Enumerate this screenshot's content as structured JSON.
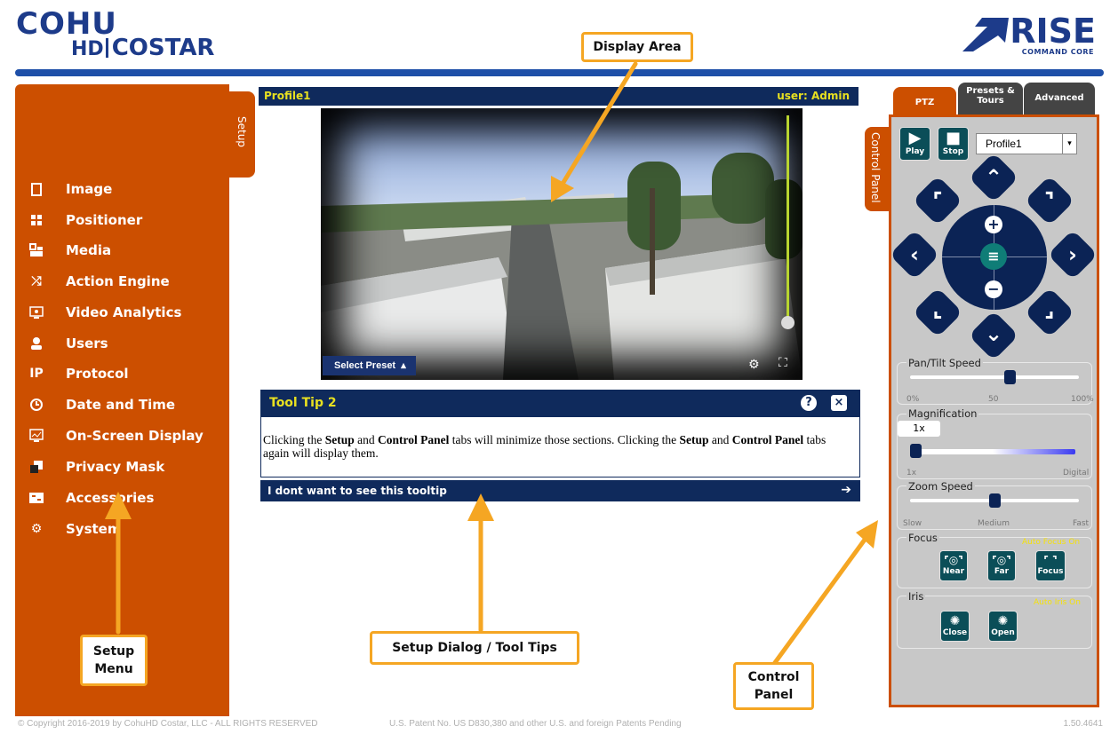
{
  "brand": {
    "cohu": "COHU",
    "hd": "HD",
    "costar": "COSTAR",
    "rise": "RISE",
    "rise_sub": "COMMAND CORE",
    "accent": "#cc4f00",
    "navy": "#0f2a5c"
  },
  "setup_menu": {
    "items": [
      {
        "icon": "image-icon",
        "label": "Image"
      },
      {
        "icon": "positioner-icon",
        "label": "Positioner"
      },
      {
        "icon": "media-icon",
        "label": "Media"
      },
      {
        "icon": "action-engine-icon",
        "label": "Action Engine"
      },
      {
        "icon": "video-analytics-icon",
        "label": "Video Analytics"
      },
      {
        "icon": "users-icon",
        "label": "Users"
      },
      {
        "icon": "protocol-icon",
        "label": "Protocol"
      },
      {
        "icon": "clock-icon",
        "label": "Date and Time"
      },
      {
        "icon": "osd-icon",
        "label": "On-Screen Display"
      },
      {
        "icon": "privacy-mask-icon",
        "label": "Privacy Mask"
      },
      {
        "icon": "accessories-icon",
        "label": "Accessories"
      },
      {
        "icon": "gear-icon",
        "label": "System"
      }
    ],
    "tab_label": "Setup"
  },
  "display": {
    "profile": "Profile1",
    "user": "user: Admin",
    "select_preset": "Select Preset"
  },
  "tooltip": {
    "title": "Tool Tip 2",
    "help": "?",
    "close": "×",
    "body_1": "Clicking the ",
    "setup": "Setup",
    "and": " and ",
    "control_panel": "Control Panel",
    "body_2": " tabs will minimize those sections. Clicking the ",
    "body_3": " tabs again will display them.",
    "dismiss": "I dont want to see this tooltip"
  },
  "control_panel": {
    "tabs": [
      "PTZ",
      "Presets & Tours",
      "Advanced"
    ],
    "side_tab": "Control Panel",
    "play": "Play",
    "stop": "Stop",
    "profile": "Profile1",
    "pan_tilt": {
      "legend": "Pan/Tilt Speed",
      "min": "0%",
      "mid": "50",
      "max": "100%",
      "value": 60
    },
    "magnification": {
      "legend": "Magnification",
      "value_label": "1x",
      "min": "1x",
      "max": "Digital",
      "value": 0
    },
    "zoom_speed": {
      "legend": "Zoom Speed",
      "min": "Slow",
      "mid": "Medium",
      "max": "Fast",
      "value": 50
    },
    "focus": {
      "legend": "Focus",
      "auto": "Auto Focus On",
      "buttons": [
        "Near",
        "Far",
        "Focus"
      ]
    },
    "iris": {
      "legend": "Iris",
      "auto": "Auto Iris On",
      "buttons": [
        "Close",
        "Open"
      ]
    }
  },
  "callouts": {
    "display_area": "Display Area",
    "setup_menu_1": "Setup",
    "setup_menu_2": "Menu",
    "tooltips": "Setup Dialog / Tool Tips",
    "control_panel_1": "Control",
    "control_panel_2": "Panel"
  },
  "footer": {
    "copyright": "© Copyright 2016-2019 by CohuHD Costar, LLC - ALL RIGHTS RESERVED",
    "patent": "U.S. Patent No. US D830,380 and other U.S. and foreign Patents Pending",
    "version": "1.50.4641"
  }
}
